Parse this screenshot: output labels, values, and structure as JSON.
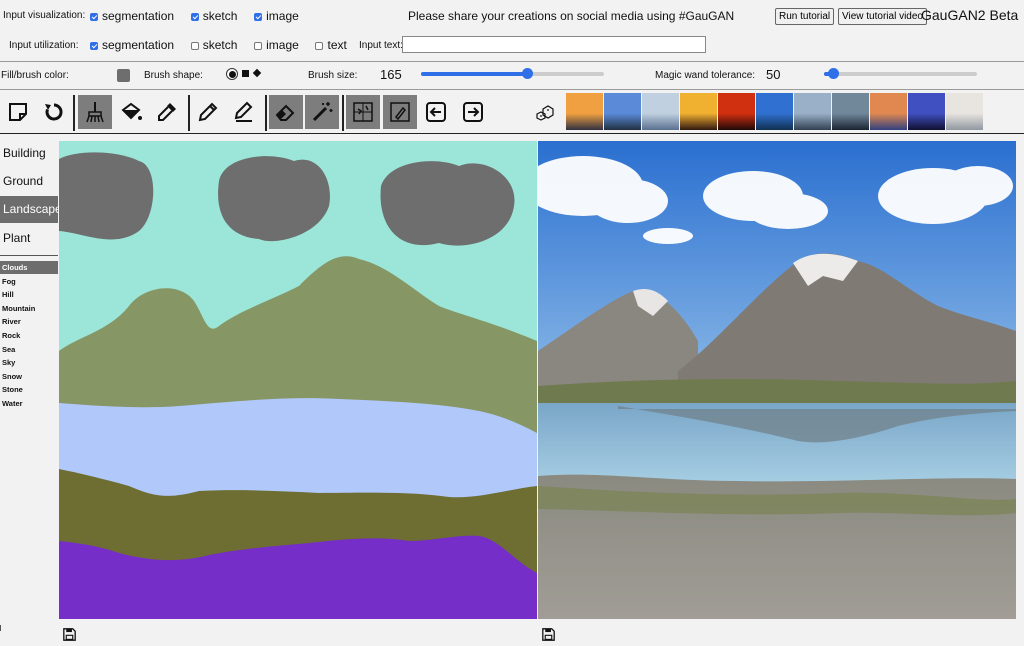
{
  "header": {
    "input_visualization_label": "Input visualization:",
    "viz_options": [
      {
        "label": "segmentation",
        "checked": true
      },
      {
        "label": "sketch",
        "checked": true
      },
      {
        "label": "image",
        "checked": true
      }
    ],
    "input_utilization_label": "Input utilization:",
    "util_options": [
      {
        "label": "segmentation",
        "checked": true
      },
      {
        "label": "sketch",
        "checked": false
      },
      {
        "label": "image",
        "checked": false
      },
      {
        "label": "text",
        "checked": false
      }
    ],
    "share_message": "Please share your creations on social media using #GauGAN",
    "run_tutorial": "Run tutorial",
    "view_tutorial_video": "View tutorial video",
    "app_title": "GauGAN2 Beta",
    "input_text_label": "Input text:",
    "input_text_value": ""
  },
  "brush": {
    "fill_color_label": "Fill/brush color:",
    "fill_color": "#6e6e6e",
    "shape_label": "Brush shape:",
    "shapes": [
      "circle",
      "square",
      "diamond"
    ],
    "size_label": "Brush size:",
    "size_value": "165",
    "size_fraction": 0.58,
    "magic_wand_label": "Magic wand tolerance:",
    "magic_wand_value": "50",
    "magic_wand_fraction": 0.06
  },
  "toolbar": {
    "tools": [
      "new-canvas",
      "undo",
      "brush",
      "paint-bucket",
      "eyedropper",
      "pencil",
      "eraser-pencil",
      "eraser",
      "magic-wand",
      "grid-segment",
      "grid-sketch",
      "arrow-left",
      "arrow-right",
      "random-dice"
    ],
    "active_tools": [
      "brush",
      "eraser",
      "magic-wand",
      "grid-segment",
      "grid-sketch"
    ],
    "style_thumbnails": [
      {
        "name": "sunset-lake",
        "c1": "#f0a040",
        "c2": "#303040"
      },
      {
        "name": "blue-sky-road",
        "c1": "#5a8ad8",
        "c2": "#203040"
      },
      {
        "name": "sea-horizon",
        "c1": "#c0d0e0",
        "c2": "#5a7090"
      },
      {
        "name": "orange-sunset",
        "c1": "#f0b030",
        "c2": "#301810"
      },
      {
        "name": "red-sky",
        "c1": "#d03010",
        "c2": "#200808"
      },
      {
        "name": "blue-lake",
        "c1": "#3070d0",
        "c2": "#103050"
      },
      {
        "name": "gray-coast",
        "c1": "#9ab0c8",
        "c2": "#304050"
      },
      {
        "name": "dark-horizon",
        "c1": "#70889a",
        "c2": "#1a2230"
      },
      {
        "name": "dusk-clouds",
        "c1": "#e08850",
        "c2": "#304080"
      },
      {
        "name": "night-lake",
        "c1": "#4050c0",
        "c2": "#101030"
      },
      {
        "name": "pale-sea",
        "c1": "#e8e4e0",
        "c2": "#9098a0"
      }
    ]
  },
  "categories": [
    {
      "label": "Building",
      "active": false
    },
    {
      "label": "Ground",
      "active": false
    },
    {
      "label": "Landscape",
      "active": true
    },
    {
      "label": "Plant",
      "active": false
    }
  ],
  "subcategories": [
    {
      "label": "Clouds",
      "active": true
    },
    {
      "label": "Fog",
      "active": false
    },
    {
      "label": "Hill",
      "active": false
    },
    {
      "label": "Mountain",
      "active": false
    },
    {
      "label": "River",
      "active": false
    },
    {
      "label": "Rock",
      "active": false
    },
    {
      "label": "Sea",
      "active": false
    },
    {
      "label": "Sky",
      "active": false
    },
    {
      "label": "Snow",
      "active": false
    },
    {
      "label": "Stone",
      "active": false
    },
    {
      "label": "Water",
      "active": false
    }
  ],
  "segmentation_colors": {
    "sky": "#9be6d8",
    "clouds": "#6e6e6e",
    "mountain": "#869664",
    "water": "#b1c8fa",
    "hill": "#6e6e32",
    "flower": "#762ec8"
  },
  "footer": {
    "save_icons": [
      "save-segmentation-icon",
      "save-output-icon"
    ]
  }
}
